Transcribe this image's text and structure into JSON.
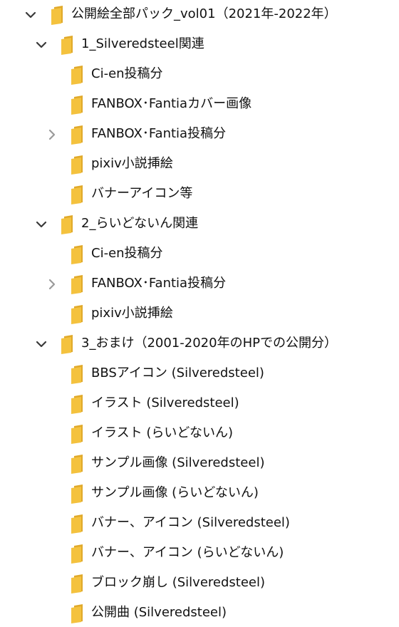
{
  "colors": {
    "folder_front": "#f4c23e",
    "folder_back": "#e0a92a",
    "chevron": "#3a3a3a",
    "chevron_collapsed": "#9a9a9a",
    "text": "#111111"
  },
  "icons": {
    "expanded": "chevron-down-icon",
    "collapsed": "chevron-right-icon",
    "folder": "folder-icon"
  },
  "tree": {
    "root": {
      "label": "公開絵全部パック_vol01（2021年-2022年）",
      "state": "expanded",
      "children": [
        {
          "label": "1_Silveredsteel関連",
          "state": "expanded",
          "children": [
            {
              "label": "Ci-en投稿分",
              "state": "none"
            },
            {
              "label": "FANBOX･Fantiaカバー画像",
              "state": "none"
            },
            {
              "label": "FANBOX･Fantia投稿分",
              "state": "collapsed"
            },
            {
              "label": "pixiv小説挿絵",
              "state": "none"
            },
            {
              "label": "バナーアイコン等",
              "state": "none"
            }
          ]
        },
        {
          "label": "2_らいどないん関連",
          "state": "expanded",
          "children": [
            {
              "label": "Ci-en投稿分",
              "state": "none"
            },
            {
              "label": "FANBOX･Fantia投稿分",
              "state": "collapsed"
            },
            {
              "label": "pixiv小説挿絵",
              "state": "none"
            }
          ]
        },
        {
          "label": "3_おまけ（2001-2020年のHPでの公開分）",
          "state": "expanded",
          "children": [
            {
              "label": "BBSアイコン (Silveredsteel)",
              "state": "none"
            },
            {
              "label": "イラスト (Silveredsteel)",
              "state": "none"
            },
            {
              "label": "イラスト (らいどないん)",
              "state": "none"
            },
            {
              "label": "サンプル画像 (Silveredsteel)",
              "state": "none"
            },
            {
              "label": "サンプル画像 (らいどないん)",
              "state": "none"
            },
            {
              "label": "バナー、アイコン (Silveredsteel)",
              "state": "none"
            },
            {
              "label": "バナー、アイコン (らいどないん)",
              "state": "none"
            },
            {
              "label": "ブロック崩し (Silveredsteel)",
              "state": "none"
            },
            {
              "label": "公開曲 (Silveredsteel)",
              "state": "none"
            }
          ]
        }
      ]
    }
  }
}
